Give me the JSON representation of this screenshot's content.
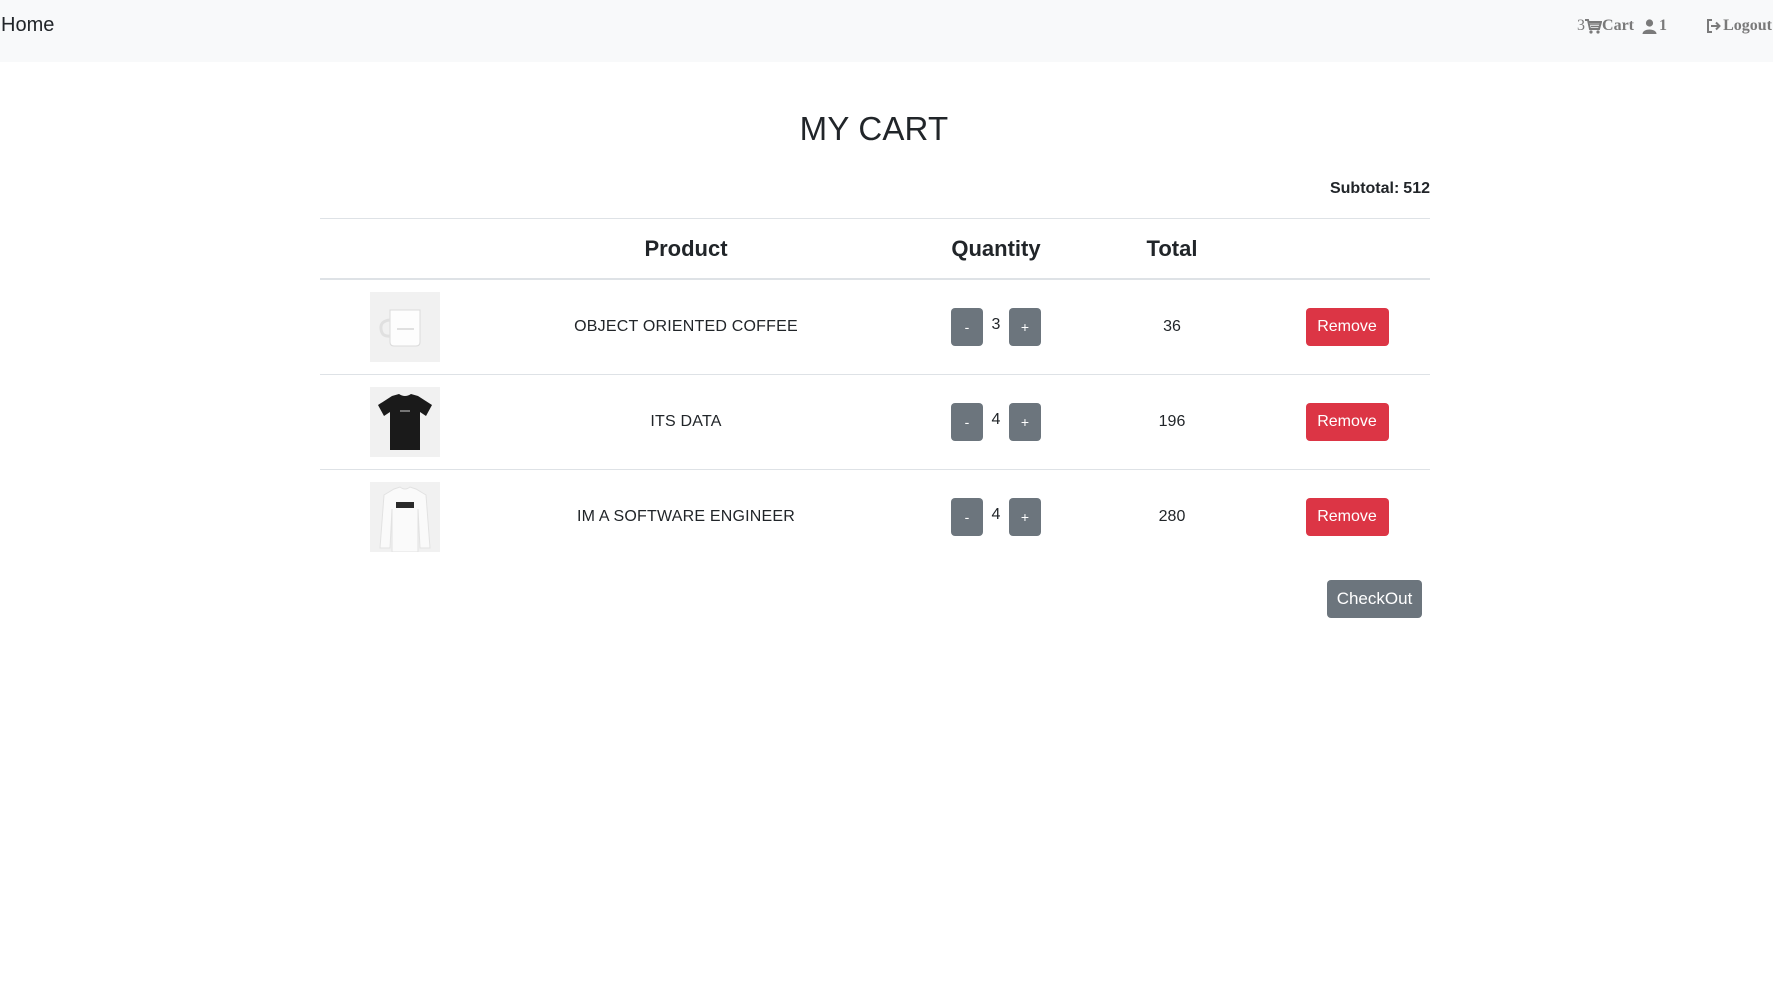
{
  "navbar": {
    "home_label": "Home",
    "cart_count": "3",
    "cart_label": "Cart",
    "user_count": "1",
    "logout_label": "Logout",
    "link_color": "#7a7a7a",
    "background": "#f8f9fa"
  },
  "page": {
    "title": "MY CART",
    "subtotal_label": "Subtotal:",
    "subtotal_value": "512"
  },
  "table": {
    "headers": {
      "image": "",
      "product": "Product",
      "quantity": "Quantity",
      "total": "Total",
      "action": ""
    },
    "rows": [
      {
        "image_icon": "mug-image",
        "product": "OBJECT ORIENTED COFFEE",
        "qty": "3",
        "total": "36",
        "decrement": "-",
        "increment": "+",
        "remove": "Remove"
      },
      {
        "image_icon": "black-tshirt-image",
        "product": "ITS DATA",
        "qty": "4",
        "total": "196",
        "decrement": "-",
        "increment": "+",
        "remove": "Remove"
      },
      {
        "image_icon": "white-longsleeve-image",
        "product": "IM A SOFTWARE ENGINEER",
        "qty": "4",
        "total": "280",
        "decrement": "-",
        "increment": "+",
        "remove": "Remove"
      }
    ]
  },
  "checkout_label": "CheckOut",
  "colors": {
    "danger": "#dc3545",
    "secondary": "#6c757d"
  }
}
